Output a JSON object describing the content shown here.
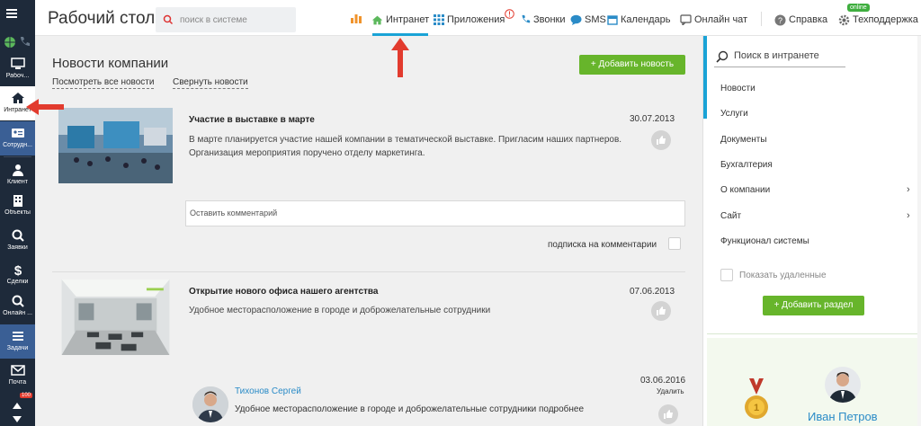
{
  "header": {
    "title": "Рабочий стол",
    "search_placeholder": "поиск в системе",
    "nav": {
      "intranet": "Интранет",
      "apps": "Приложения",
      "calls": "Звонки",
      "sms": "SMS",
      "calendar": "Календарь",
      "chat": "Онлайн чат",
      "help": "Справка",
      "support": "Техподдержка",
      "online_badge": "online"
    }
  },
  "rail": {
    "items": [
      {
        "label": "Рабоч..."
      },
      {
        "label": "Интранет"
      },
      {
        "label": "Сотрудн..."
      },
      {
        "label": "Клиент"
      },
      {
        "label": "Объекты"
      },
      {
        "label": "Заявки"
      },
      {
        "label": "Сделки"
      },
      {
        "label": "Онлайн ..."
      },
      {
        "label": "Задачи"
      },
      {
        "label": "Почта"
      }
    ],
    "mail_badge": "100"
  },
  "main": {
    "section_title": "Новости компании",
    "link_all": "Посмотреть все новости",
    "link_collapse": "Свернуть новости",
    "add_news": "+ Добавить новость",
    "news": [
      {
        "title": "Участие в выставке в марте",
        "date": "30.07.2013",
        "text1": "В марте планируется участие нашей компании в тематической выставке. Пригласим наших партнеров.",
        "text2": "Организация мероприятия поручено отделу маркетинга."
      },
      {
        "title": "Открытие нового офиса нашего агентства",
        "date": "07.06.2013",
        "text1": "Удобное месторасположение в городе и доброжелательные сотрудники"
      }
    ],
    "comment_placeholder": "Оставить комментарий",
    "subscribe": "подписка на комментарии",
    "comment": {
      "author": "Тихонов Сергей",
      "date": "03.06.2016",
      "delete": "Удалить",
      "text": "Удобное месторасположение в городе и доброжелательные сотрудники подробнее"
    }
  },
  "sidebar": {
    "search_placeholder": "Поиск в интранете",
    "items": [
      "Новости",
      "Услуги",
      "Документы",
      "Бухгалтерия",
      "О компании",
      "Сайт",
      "Функционал системы"
    ],
    "show_deleted": "Показать удаленные",
    "add_section": "+ Добавить раздел",
    "person_name": "Иван Петров"
  },
  "colors": {
    "accent": "#1aa3d6",
    "green": "#67b52b",
    "rail": "#1e2a3a",
    "arrow": "#e23b2e"
  }
}
